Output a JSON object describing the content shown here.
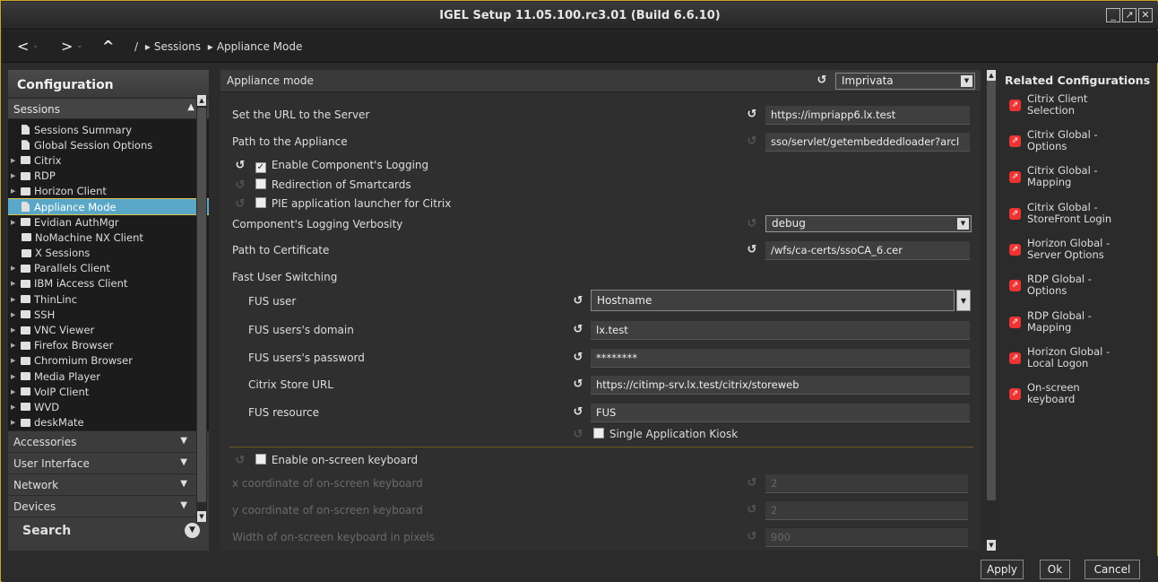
{
  "window": {
    "title": "IGEL Setup 11.05.100.rc3.01 (Build 6.6.10)",
    "btn_min": "_",
    "btn_max": "↗",
    "btn_close": "✕"
  },
  "nav": {
    "back": "<",
    "forward": ">",
    "up": "^",
    "dd": "⌄",
    "root": "/",
    "crumb1": "Sessions",
    "crumb2": "Appliance Mode"
  },
  "left": {
    "title": "Configuration",
    "sessions_header": "Sessions",
    "tree": [
      {
        "label": "Sessions Summary",
        "type": "doc"
      },
      {
        "label": "Global Session Options",
        "type": "doc"
      },
      {
        "label": "Citrix",
        "type": "folder"
      },
      {
        "label": "RDP",
        "type": "folder"
      },
      {
        "label": "Horizon Client",
        "type": "folder"
      },
      {
        "label": "Appliance Mode",
        "type": "doc"
      },
      {
        "label": "Evidian AuthMgr",
        "type": "folder"
      },
      {
        "label": "NoMachine NX Client",
        "type": "folder"
      },
      {
        "label": "X Sessions",
        "type": "folder"
      },
      {
        "label": "Parallels Client",
        "type": "folder"
      },
      {
        "label": "IBM iAccess Client",
        "type": "folder"
      },
      {
        "label": "ThinLinc",
        "type": "folder"
      },
      {
        "label": "SSH",
        "type": "folder"
      },
      {
        "label": "VNC Viewer",
        "type": "folder"
      },
      {
        "label": "Firefox Browser",
        "type": "folder"
      },
      {
        "label": "Chromium Browser",
        "type": "folder"
      },
      {
        "label": "Media Player",
        "type": "folder"
      },
      {
        "label": "VoIP Client",
        "type": "folder"
      },
      {
        "label": "WVD",
        "type": "folder"
      },
      {
        "label": "deskMate",
        "type": "folder"
      }
    ],
    "accessories": "Accessories",
    "user_interface": "User Interface",
    "network": "Network",
    "devices": "Devices",
    "search": "Search"
  },
  "main": {
    "header": "Appliance mode",
    "mode_value": "Imprivata",
    "url_label": "Set the URL to the Server",
    "url_value": "https://impriapp6.lx.test",
    "path_label": "Path to the Appliance",
    "path_value": "sso/servlet/getembeddedloader?arcl",
    "enable_logging": "Enable Component's Logging",
    "redirection": "Redirection of Smartcards",
    "pie_launcher": "PIE application launcher for Citrix",
    "verbosity_label": "Component's Logging Verbosity",
    "verbosity_value": "debug",
    "cert_label": "Path to Certificate",
    "cert_value": "/wfs/ca-certs/ssoCA_6.cer",
    "fus_header": "Fast User Switching",
    "fus_user_label": "FUS user",
    "fus_user_value": "Hostname",
    "fus_domain_label": "FUS users's domain",
    "fus_domain_value": "lx.test",
    "fus_password_label": "FUS users's password",
    "fus_password_value": "********",
    "citrix_store_label": "Citrix Store URL",
    "citrix_store_value": "https://citimp-srv.lx.test/citrix/storeweb",
    "fus_resource_label": "FUS resource",
    "fus_resource_value": "FUS",
    "single_kiosk": "Single Application Kiosk",
    "enable_osk": "Enable on-screen keyboard",
    "osk_x_label": "x coordinate of on-screen keyboard",
    "osk_x_value": "2",
    "osk_y_label": "y coordinate of on-screen keyboard",
    "osk_y_value": "2",
    "osk_w_label": "Width of on-screen keyboard in pixels",
    "osk_w_value": "900"
  },
  "right": {
    "title": "Related Configurations",
    "items": [
      {
        "l1": "Citrix Client",
        "l2": "Selection"
      },
      {
        "l1": "Citrix Global -",
        "l2": "Options"
      },
      {
        "l1": "Citrix Global -",
        "l2": "Mapping"
      },
      {
        "l1": "Citrix Global -",
        "l2": "StoreFront Login"
      },
      {
        "l1": "Horizon Global -",
        "l2": "Server Options"
      },
      {
        "l1": "RDP Global -",
        "l2": "Options"
      },
      {
        "l1": "RDP Global -",
        "l2": "Mapping"
      },
      {
        "l1": "Horizon Global -",
        "l2": "Local Logon"
      },
      {
        "l1": "On-screen",
        "l2": "keyboard"
      }
    ]
  },
  "buttons": {
    "apply": "Apply",
    "ok": "Ok",
    "cancel": "Cancel"
  },
  "colors": {
    "accent_border": "#c9a227",
    "selected_bg": "#5aa7c7",
    "related_icon": "#e33333"
  }
}
